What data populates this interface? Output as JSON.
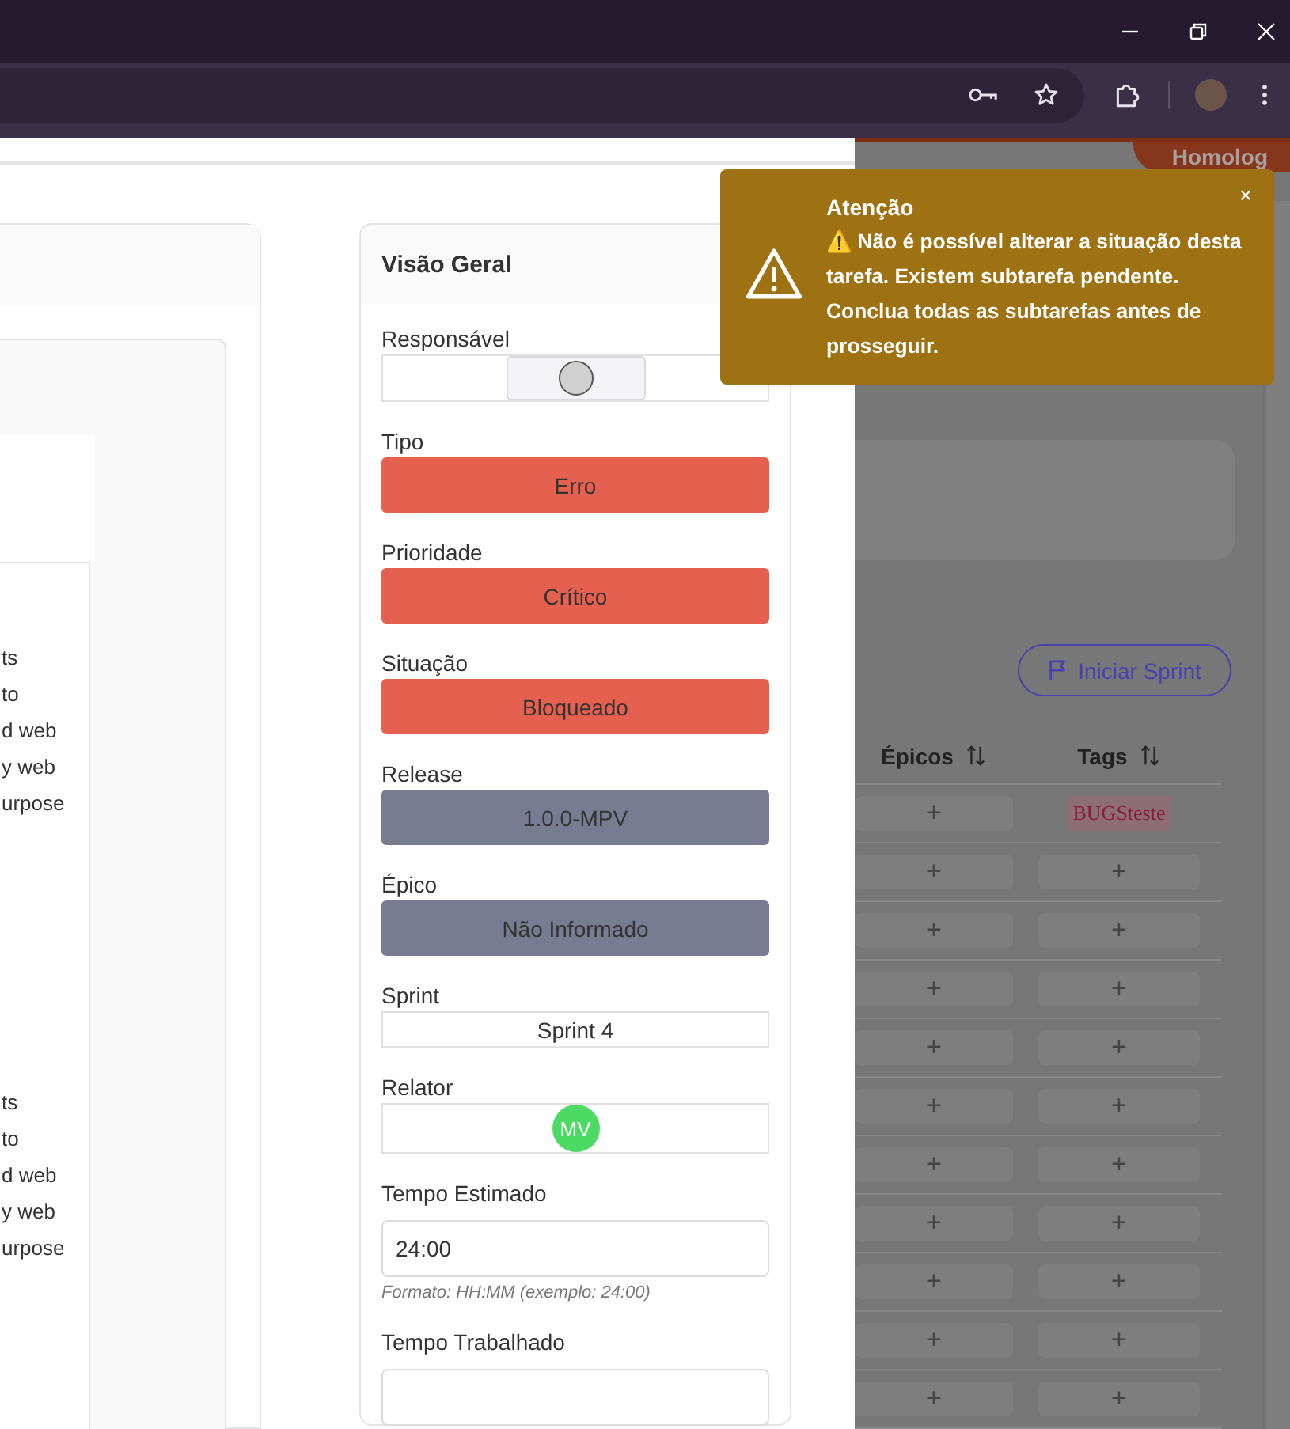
{
  "left_panel": {
    "text_groups": [
      [
        "ts",
        "to",
        "d web",
        "y web",
        "urpose"
      ],
      [
        "ts",
        "to",
        "d web",
        "y web",
        "urpose"
      ]
    ]
  },
  "overview": {
    "title": "Visão Geral",
    "fields": [
      {
        "label": "Responsável",
        "kind": "avatar",
        "color": "#d0d0d0"
      },
      {
        "label": "Tipo",
        "kind": "pill",
        "value": "Erro",
        "color": "#e5604f"
      },
      {
        "label": "Prioridade",
        "kind": "pill",
        "value": "Crítico",
        "color": "#e5604f"
      },
      {
        "label": "Situação",
        "kind": "pill",
        "value": "Bloqueado",
        "color": "#e5604f"
      },
      {
        "label": "Release",
        "kind": "pill",
        "value": "1.0.0-MPV",
        "color": "#787c93"
      },
      {
        "label": "Épico",
        "kind": "pill",
        "value": "Não Informado",
        "color": "#787c93"
      },
      {
        "label": "Sprint",
        "kind": "select",
        "value": "Sprint 4"
      },
      {
        "label": "Relator",
        "kind": "avatar",
        "initials": "MV",
        "color": "#4cd964"
      },
      {
        "label": "Tempo Estimado",
        "kind": "input",
        "value": "24:00",
        "hint": "Formato: HH:MM (exemplo: 24:00)"
      },
      {
        "label": "Tempo Trabalhado",
        "kind": "input"
      }
    ]
  },
  "background": {
    "env_badge": "Homolog",
    "start_sprint_button": "Iniciar Sprint",
    "columns": [
      "Épicos",
      "Tags"
    ],
    "rows": [
      {
        "epic": "+",
        "tag": "BUGSteste",
        "kind": "label"
      },
      {
        "epic": "+",
        "tag": "+",
        "kind": "add"
      },
      {
        "epic": "+",
        "tag": "+",
        "kind": "add"
      },
      {
        "epic": "+",
        "tag": "+",
        "kind": "add"
      },
      {
        "epic": "+",
        "tag": "+",
        "kind": "add"
      },
      {
        "epic": "+",
        "tag": "+",
        "kind": "add"
      },
      {
        "epic": "+",
        "tag": "+",
        "kind": "add"
      },
      {
        "epic": "+",
        "tag": "+",
        "kind": "add"
      },
      {
        "epic": "+",
        "tag": "+",
        "kind": "add"
      },
      {
        "epic": "+",
        "tag": "+",
        "kind": "add"
      },
      {
        "epic": "+",
        "tag": "+",
        "kind": "add"
      }
    ]
  },
  "toast": {
    "title": "Atenção",
    "message": "⚠️ Não é possível alterar a situação desta tarefa. Existem subtarefa pendente. Conclua todas as subtarefas antes de prosseguir.",
    "close": "×"
  }
}
